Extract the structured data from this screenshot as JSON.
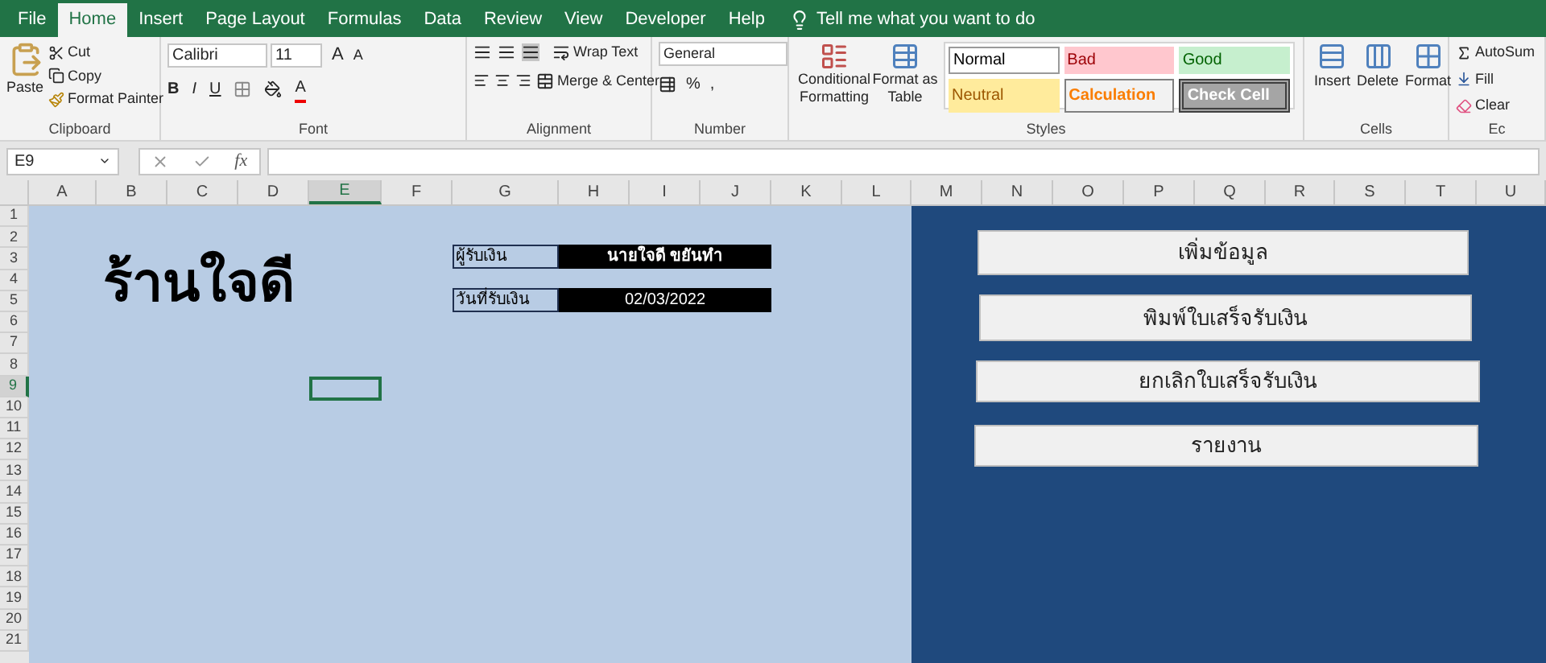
{
  "tabs": [
    {
      "label": "File",
      "selected": false
    },
    {
      "label": "Home",
      "selected": true
    },
    {
      "label": "Insert",
      "selected": false
    },
    {
      "label": "Page Layout",
      "selected": false
    },
    {
      "label": "Formulas",
      "selected": false
    },
    {
      "label": "Data",
      "selected": false
    },
    {
      "label": "Review",
      "selected": false
    },
    {
      "label": "View",
      "selected": false
    },
    {
      "label": "Developer",
      "selected": false
    },
    {
      "label": "Help",
      "selected": false
    }
  ],
  "tell_me": "Tell me what you want to do",
  "ribbon": {
    "clipboard": {
      "paste": "Paste",
      "cut": "Cut",
      "copy": "Copy",
      "format_painter": "Format Painter",
      "label": "Clipboard"
    },
    "font": {
      "name": "Calibri",
      "size": "11",
      "bold": "B",
      "italic": "I",
      "underline": "U",
      "grow": "A",
      "shrink": "A",
      "font_color_letter": "A",
      "label": "Font"
    },
    "alignment": {
      "wrap": "Wrap Text",
      "merge": "Merge & Center",
      "label": "Alignment"
    },
    "number": {
      "format": "General",
      "percent": "%",
      "comma": ",",
      "label": "Number"
    },
    "styles": {
      "conditional": "Conditional",
      "conditional_2": "Formatting",
      "format_table": "Format as",
      "format_table_2": "Table",
      "label": "Styles",
      "presets": [
        {
          "label": "Normal",
          "kind": "normal"
        },
        {
          "label": "Bad",
          "kind": "bad"
        },
        {
          "label": "Good",
          "kind": "good"
        },
        {
          "label": "Neutral",
          "kind": "neutral"
        },
        {
          "label": "Calculation",
          "kind": "calculation"
        },
        {
          "label": "Check Cell",
          "kind": "check"
        }
      ]
    },
    "cells": {
      "insert": "Insert",
      "delete": "Delete",
      "format": "Format",
      "label": "Cells"
    },
    "editing": {
      "autosum": "AutoSum",
      "fill": "Fill",
      "clear": "Clear",
      "label": "Ec"
    }
  },
  "name_box": "E9",
  "function_symbol": "fx",
  "columns": [
    {
      "letter": "A",
      "selected": false
    },
    {
      "letter": "B",
      "selected": false
    },
    {
      "letter": "C",
      "selected": false
    },
    {
      "letter": "D",
      "selected": false
    },
    {
      "letter": "E",
      "selected": true
    },
    {
      "letter": "F",
      "selected": false
    },
    {
      "letter": "G",
      "selected": false
    },
    {
      "letter": "H",
      "selected": false
    },
    {
      "letter": "I",
      "selected": false
    },
    {
      "letter": "J",
      "selected": false
    },
    {
      "letter": "K",
      "selected": false
    },
    {
      "letter": "L",
      "selected": false
    },
    {
      "letter": "M",
      "selected": false
    },
    {
      "letter": "N",
      "selected": false
    },
    {
      "letter": "O",
      "selected": false
    },
    {
      "letter": "P",
      "selected": false
    },
    {
      "letter": "Q",
      "selected": false
    },
    {
      "letter": "R",
      "selected": false
    },
    {
      "letter": "S",
      "selected": false
    },
    {
      "letter": "T",
      "selected": false
    },
    {
      "letter": "U",
      "selected": false
    }
  ],
  "rows": [
    {
      "number": "1",
      "selected": false
    },
    {
      "number": "2",
      "selected": false
    },
    {
      "number": "3",
      "selected": false
    },
    {
      "number": "4",
      "selected": false
    },
    {
      "number": "5",
      "selected": false
    },
    {
      "number": "6",
      "selected": false
    },
    {
      "number": "7",
      "selected": false
    },
    {
      "number": "8",
      "selected": false
    },
    {
      "number": "9",
      "selected": true
    },
    {
      "number": "10",
      "selected": false
    },
    {
      "number": "11",
      "selected": false
    },
    {
      "number": "12",
      "selected": false
    },
    {
      "number": "13",
      "selected": false
    },
    {
      "number": "14",
      "selected": false
    },
    {
      "number": "15",
      "selected": false
    },
    {
      "number": "16",
      "selected": false
    },
    {
      "number": "17",
      "selected": false
    },
    {
      "number": "18",
      "selected": false
    },
    {
      "number": "19",
      "selected": false
    },
    {
      "number": "20",
      "selected": false
    },
    {
      "number": "21",
      "selected": false
    }
  ],
  "sheet": {
    "title": "ร้านใจดี",
    "fields": [
      {
        "label": "ผู้รับเงิน",
        "value": "นายใจดี ขยันทำ",
        "bold": true
      },
      {
        "label": "วันที่รับเงิน",
        "value": "02/03/2022",
        "bold": false
      }
    ],
    "buttons": [
      "เพิ่มข้อมูล",
      "พิมพ์ใบเสร็จรับเงิน",
      "ยกเลิกใบเสร็จรับเงิน",
      "รายงาน"
    ]
  }
}
